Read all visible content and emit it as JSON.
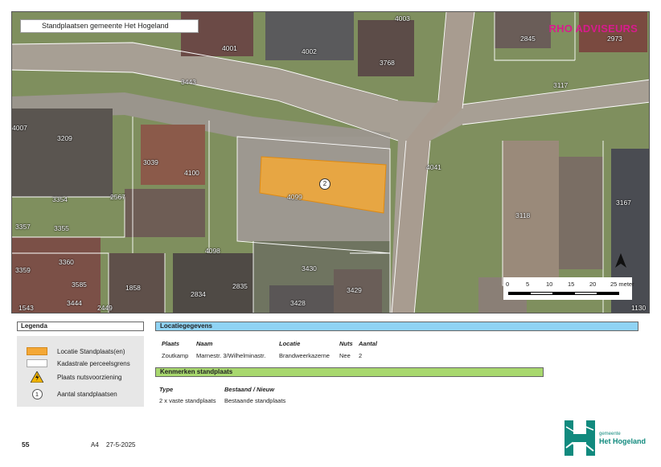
{
  "map": {
    "title": "Standplaatsen gemeente Het Hogeland",
    "brand": "RHO ADVISEURS",
    "site_number": "2",
    "north_symbol": "north-arrow",
    "parcels": [
      "2845",
      "2973",
      "4003",
      "4001",
      "4002",
      "3768",
      "3443",
      "3117",
      "4007",
      "3209",
      "3039",
      "4100",
      "4041",
      "4099",
      "2567",
      "3354",
      "3357",
      "3355",
      "3118",
      "3167",
      "4098",
      "3430",
      "3359",
      "3360",
      "1858",
      "2835",
      "3429",
      "3585",
      "2834",
      "3428",
      "3444",
      "1543",
      "2449",
      "1130"
    ],
    "scale": {
      "ticks": [
        "0",
        "5",
        "10",
        "15",
        "20",
        "25 meter"
      ]
    },
    "colors": {
      "site": "#f4a836",
      "parcel_line": "#ffffff"
    }
  },
  "legend": {
    "title": "Legenda",
    "items": [
      {
        "label": "Locatie Standplaats(en)",
        "icon": "orange-swatch"
      },
      {
        "label": "Kadastrale perceelsgrens",
        "icon": "white-swatch"
      },
      {
        "label": "Plaats nutsvoorziening",
        "icon": "warning-icon"
      },
      {
        "label": "Aantal standplaatsen",
        "icon": "number-circle",
        "symbol": "1"
      }
    ]
  },
  "locatie": {
    "title": "Locatiegegevens",
    "headers": {
      "plaats": "Plaats",
      "naam": "Naam",
      "locatie": "Locatie",
      "nuts": "Nuts",
      "aantal": "Aantal"
    },
    "row": {
      "plaats": "Zoutkamp",
      "naam": "Marnestr. 3/Wilhelminastr.",
      "locatie": "Brandweerkazerne",
      "nuts": "Nee",
      "aantal": "2"
    }
  },
  "kenmerken": {
    "title": "Kenmerken standplaats",
    "headers": {
      "type": "Type",
      "bestaand": "Bestaand / Nieuw"
    },
    "row": {
      "type": "2 x vaste standplaats",
      "bestaand": "Bestaande standplaats"
    }
  },
  "footer": {
    "page": "55",
    "paper": "A4",
    "date": "27-5-2025",
    "logo_small": "gemeente",
    "logo_big": "Het Hogeland"
  }
}
